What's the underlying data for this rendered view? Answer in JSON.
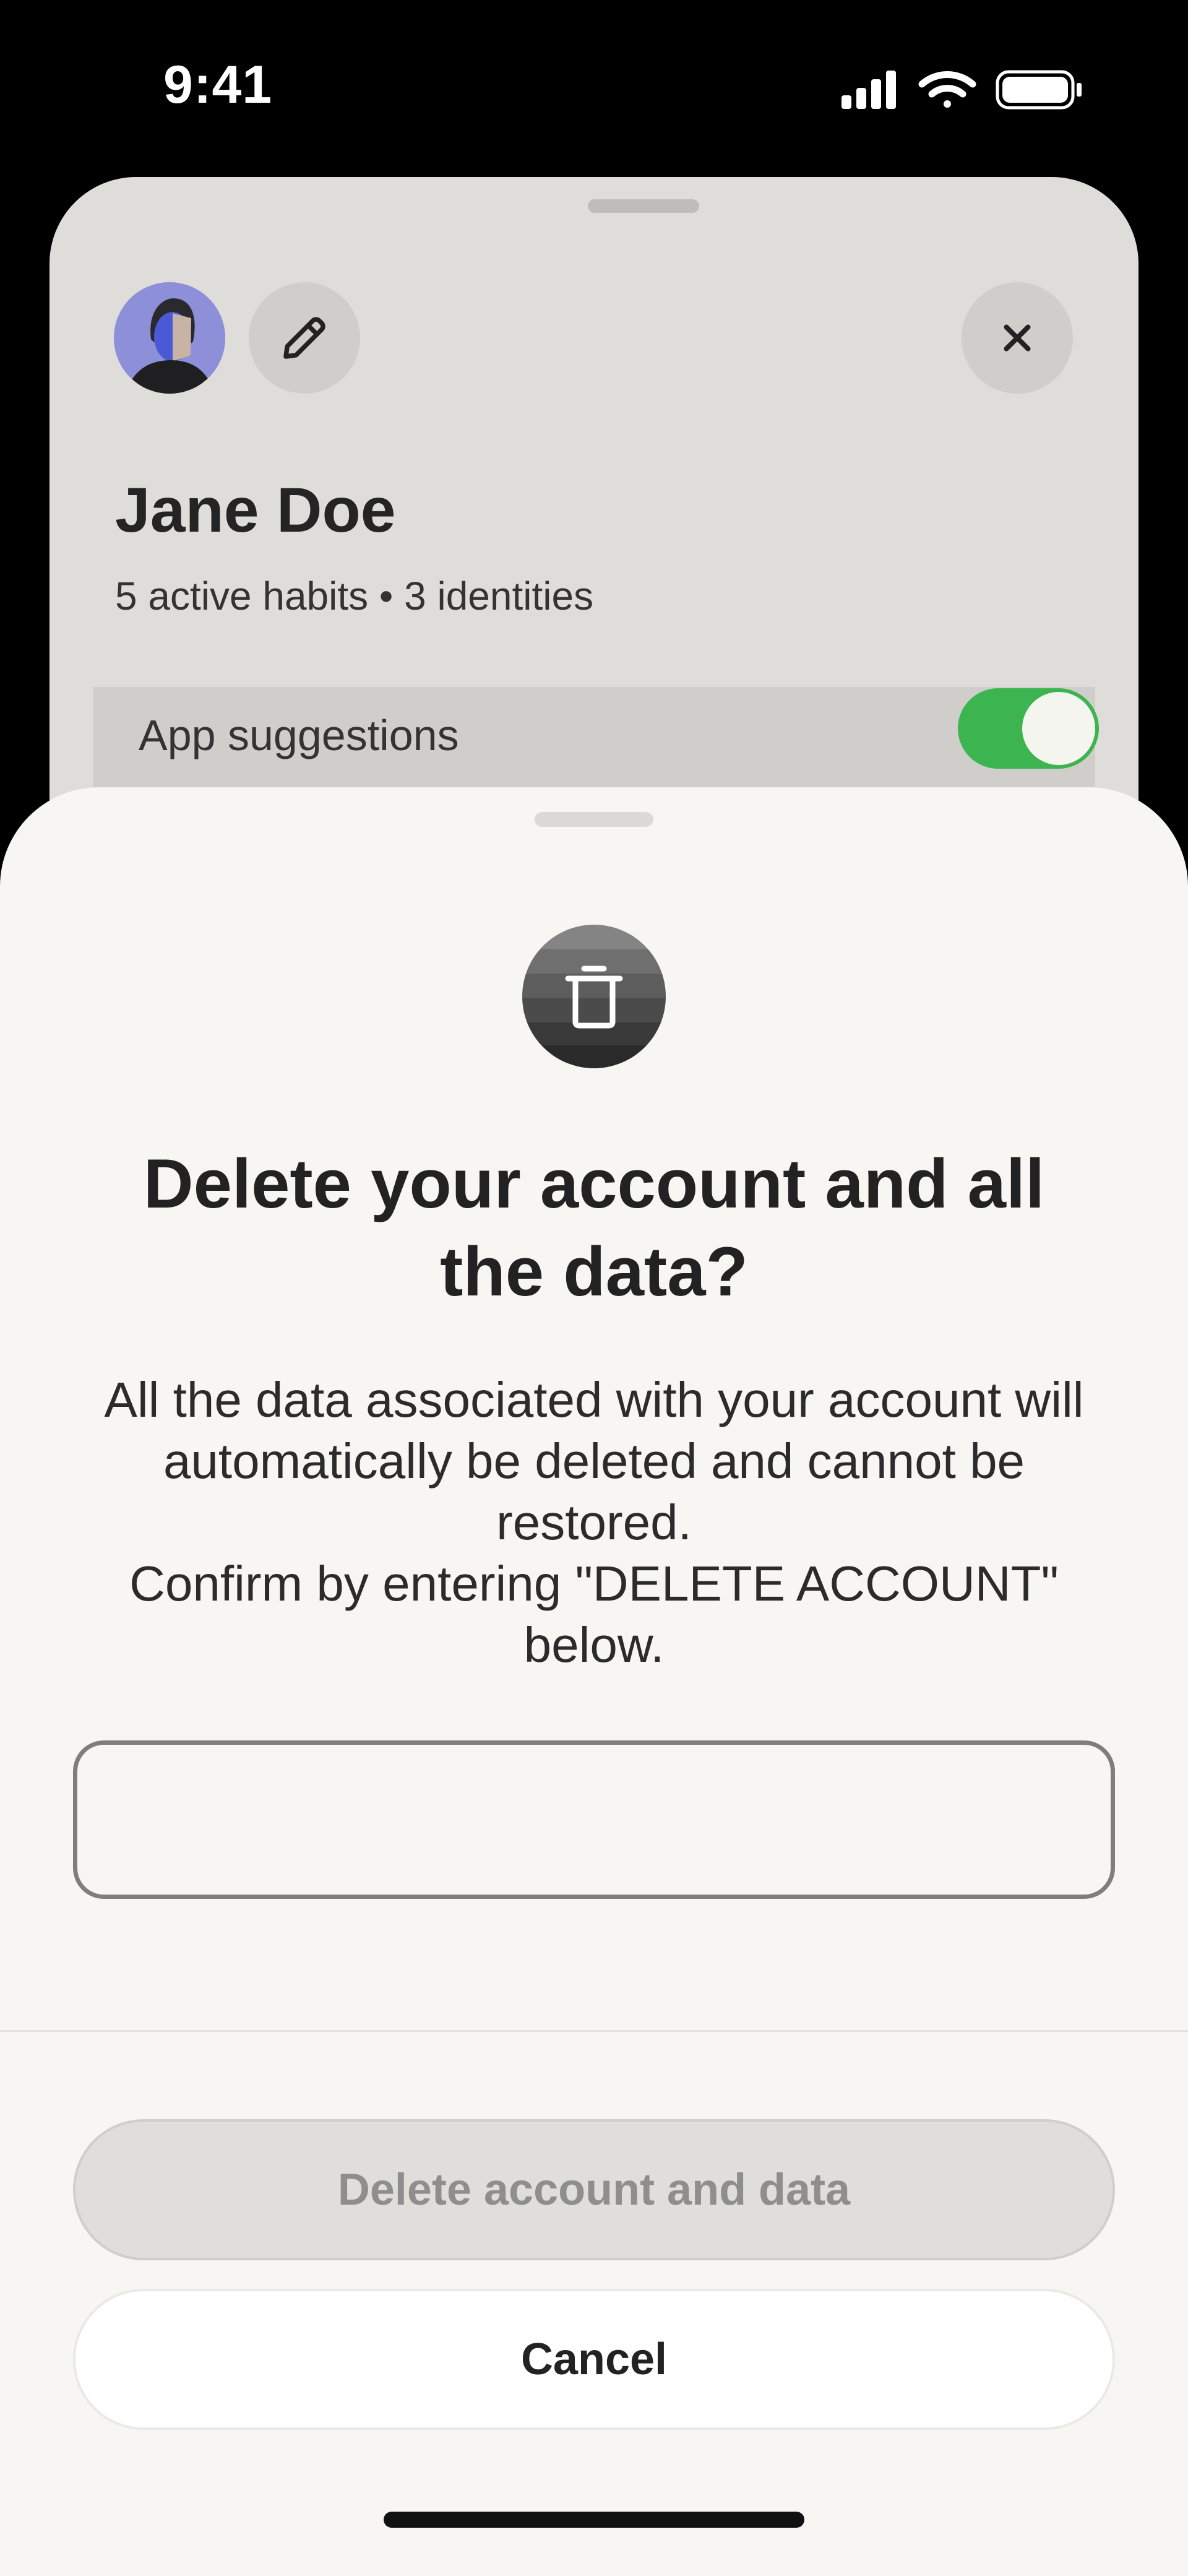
{
  "status_bar": {
    "time": "9:41",
    "icons": [
      "cellular-signal-icon",
      "wifi-icon",
      "battery-icon"
    ]
  },
  "profile_sheet": {
    "name": "Jane Doe",
    "stats": "5 active habits • 3 identities",
    "setting": {
      "label": "App suggestions",
      "enabled": true
    },
    "icons": [
      "avatar",
      "pencil-icon",
      "close-icon"
    ]
  },
  "delete_dialog": {
    "icon": "trash-icon",
    "title": "Delete your account and all the data?",
    "body_line_1": "All the data associated with your account will automatically be deleted and cannot be restored.",
    "body_line_2": "Confirm by entering \"DELETE ACCOUNT\" below.",
    "input_value": "",
    "delete_label": "Delete account and data",
    "cancel_label": "Cancel"
  },
  "colors": {
    "backdrop": "#000000",
    "sheet_background": "#f8f6f2",
    "back_sheet_background": "#deddda",
    "toggle_on": "#3cb44f",
    "disabled_button_text": "#8e8e8e"
  }
}
